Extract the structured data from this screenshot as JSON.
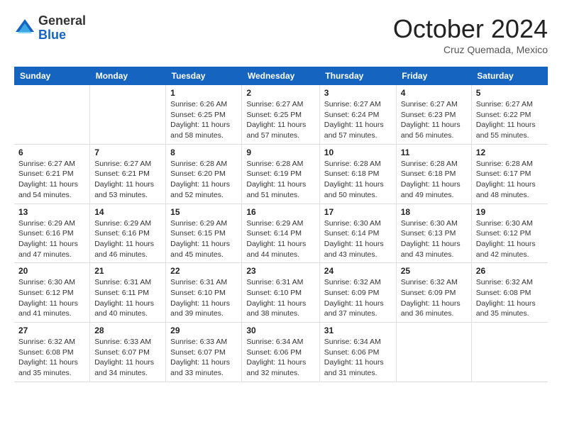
{
  "logo": {
    "general": "General",
    "blue": "Blue"
  },
  "title": "October 2024",
  "location": "Cruz Quemada, Mexico",
  "days_of_week": [
    "Sunday",
    "Monday",
    "Tuesday",
    "Wednesday",
    "Thursday",
    "Friday",
    "Saturday"
  ],
  "weeks": [
    [
      {
        "day": "",
        "sunrise": "",
        "sunset": "",
        "daylight": ""
      },
      {
        "day": "",
        "sunrise": "",
        "sunset": "",
        "daylight": ""
      },
      {
        "day": "1",
        "sunrise": "Sunrise: 6:26 AM",
        "sunset": "Sunset: 6:25 PM",
        "daylight": "Daylight: 11 hours and 58 minutes."
      },
      {
        "day": "2",
        "sunrise": "Sunrise: 6:27 AM",
        "sunset": "Sunset: 6:25 PM",
        "daylight": "Daylight: 11 hours and 57 minutes."
      },
      {
        "day": "3",
        "sunrise": "Sunrise: 6:27 AM",
        "sunset": "Sunset: 6:24 PM",
        "daylight": "Daylight: 11 hours and 57 minutes."
      },
      {
        "day": "4",
        "sunrise": "Sunrise: 6:27 AM",
        "sunset": "Sunset: 6:23 PM",
        "daylight": "Daylight: 11 hours and 56 minutes."
      },
      {
        "day": "5",
        "sunrise": "Sunrise: 6:27 AM",
        "sunset": "Sunset: 6:22 PM",
        "daylight": "Daylight: 11 hours and 55 minutes."
      }
    ],
    [
      {
        "day": "6",
        "sunrise": "Sunrise: 6:27 AM",
        "sunset": "Sunset: 6:21 PM",
        "daylight": "Daylight: 11 hours and 54 minutes."
      },
      {
        "day": "7",
        "sunrise": "Sunrise: 6:27 AM",
        "sunset": "Sunset: 6:21 PM",
        "daylight": "Daylight: 11 hours and 53 minutes."
      },
      {
        "day": "8",
        "sunrise": "Sunrise: 6:28 AM",
        "sunset": "Sunset: 6:20 PM",
        "daylight": "Daylight: 11 hours and 52 minutes."
      },
      {
        "day": "9",
        "sunrise": "Sunrise: 6:28 AM",
        "sunset": "Sunset: 6:19 PM",
        "daylight": "Daylight: 11 hours and 51 minutes."
      },
      {
        "day": "10",
        "sunrise": "Sunrise: 6:28 AM",
        "sunset": "Sunset: 6:18 PM",
        "daylight": "Daylight: 11 hours and 50 minutes."
      },
      {
        "day": "11",
        "sunrise": "Sunrise: 6:28 AM",
        "sunset": "Sunset: 6:18 PM",
        "daylight": "Daylight: 11 hours and 49 minutes."
      },
      {
        "day": "12",
        "sunrise": "Sunrise: 6:28 AM",
        "sunset": "Sunset: 6:17 PM",
        "daylight": "Daylight: 11 hours and 48 minutes."
      }
    ],
    [
      {
        "day": "13",
        "sunrise": "Sunrise: 6:29 AM",
        "sunset": "Sunset: 6:16 PM",
        "daylight": "Daylight: 11 hours and 47 minutes."
      },
      {
        "day": "14",
        "sunrise": "Sunrise: 6:29 AM",
        "sunset": "Sunset: 6:16 PM",
        "daylight": "Daylight: 11 hours and 46 minutes."
      },
      {
        "day": "15",
        "sunrise": "Sunrise: 6:29 AM",
        "sunset": "Sunset: 6:15 PM",
        "daylight": "Daylight: 11 hours and 45 minutes."
      },
      {
        "day": "16",
        "sunrise": "Sunrise: 6:29 AM",
        "sunset": "Sunset: 6:14 PM",
        "daylight": "Daylight: 11 hours and 44 minutes."
      },
      {
        "day": "17",
        "sunrise": "Sunrise: 6:30 AM",
        "sunset": "Sunset: 6:14 PM",
        "daylight": "Daylight: 11 hours and 43 minutes."
      },
      {
        "day": "18",
        "sunrise": "Sunrise: 6:30 AM",
        "sunset": "Sunset: 6:13 PM",
        "daylight": "Daylight: 11 hours and 43 minutes."
      },
      {
        "day": "19",
        "sunrise": "Sunrise: 6:30 AM",
        "sunset": "Sunset: 6:12 PM",
        "daylight": "Daylight: 11 hours and 42 minutes."
      }
    ],
    [
      {
        "day": "20",
        "sunrise": "Sunrise: 6:30 AM",
        "sunset": "Sunset: 6:12 PM",
        "daylight": "Daylight: 11 hours and 41 minutes."
      },
      {
        "day": "21",
        "sunrise": "Sunrise: 6:31 AM",
        "sunset": "Sunset: 6:11 PM",
        "daylight": "Daylight: 11 hours and 40 minutes."
      },
      {
        "day": "22",
        "sunrise": "Sunrise: 6:31 AM",
        "sunset": "Sunset: 6:10 PM",
        "daylight": "Daylight: 11 hours and 39 minutes."
      },
      {
        "day": "23",
        "sunrise": "Sunrise: 6:31 AM",
        "sunset": "Sunset: 6:10 PM",
        "daylight": "Daylight: 11 hours and 38 minutes."
      },
      {
        "day": "24",
        "sunrise": "Sunrise: 6:32 AM",
        "sunset": "Sunset: 6:09 PM",
        "daylight": "Daylight: 11 hours and 37 minutes."
      },
      {
        "day": "25",
        "sunrise": "Sunrise: 6:32 AM",
        "sunset": "Sunset: 6:09 PM",
        "daylight": "Daylight: 11 hours and 36 minutes."
      },
      {
        "day": "26",
        "sunrise": "Sunrise: 6:32 AM",
        "sunset": "Sunset: 6:08 PM",
        "daylight": "Daylight: 11 hours and 35 minutes."
      }
    ],
    [
      {
        "day": "27",
        "sunrise": "Sunrise: 6:32 AM",
        "sunset": "Sunset: 6:08 PM",
        "daylight": "Daylight: 11 hours and 35 minutes."
      },
      {
        "day": "28",
        "sunrise": "Sunrise: 6:33 AM",
        "sunset": "Sunset: 6:07 PM",
        "daylight": "Daylight: 11 hours and 34 minutes."
      },
      {
        "day": "29",
        "sunrise": "Sunrise: 6:33 AM",
        "sunset": "Sunset: 6:07 PM",
        "daylight": "Daylight: 11 hours and 33 minutes."
      },
      {
        "day": "30",
        "sunrise": "Sunrise: 6:34 AM",
        "sunset": "Sunset: 6:06 PM",
        "daylight": "Daylight: 11 hours and 32 minutes."
      },
      {
        "day": "31",
        "sunrise": "Sunrise: 6:34 AM",
        "sunset": "Sunset: 6:06 PM",
        "daylight": "Daylight: 11 hours and 31 minutes."
      },
      {
        "day": "",
        "sunrise": "",
        "sunset": "",
        "daylight": ""
      },
      {
        "day": "",
        "sunrise": "",
        "sunset": "",
        "daylight": ""
      }
    ]
  ]
}
